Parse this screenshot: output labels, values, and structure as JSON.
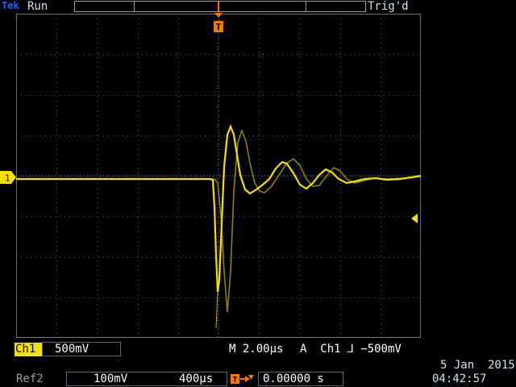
{
  "header": {
    "brand": "Tek",
    "run_state": "Run",
    "trigger_state": "Trig'd",
    "trigger_marker": "T"
  },
  "channel": {
    "marker": "1",
    "name": "Ch1",
    "scale": "500mV"
  },
  "horizontal": {
    "timebase": "M 2.00µs"
  },
  "trigger": {
    "readout": "A  Ch1 ⅃ −500mV"
  },
  "ref2": {
    "label": "Ref2",
    "volts": "100mV",
    "time": "400µs"
  },
  "delay": {
    "value": "0.00000 s"
  },
  "clock": {
    "date": "5 Jan  2015",
    "time": "04:42:57"
  },
  "colors": {
    "trace": "#f5e000",
    "brand": "#1a63ff",
    "trigger_marker": "#f07a00",
    "grid": "#6e6e6e"
  },
  "icons": {
    "trigger_level": "left-arrow-icon",
    "delay": "trigger-delay-icon"
  }
}
